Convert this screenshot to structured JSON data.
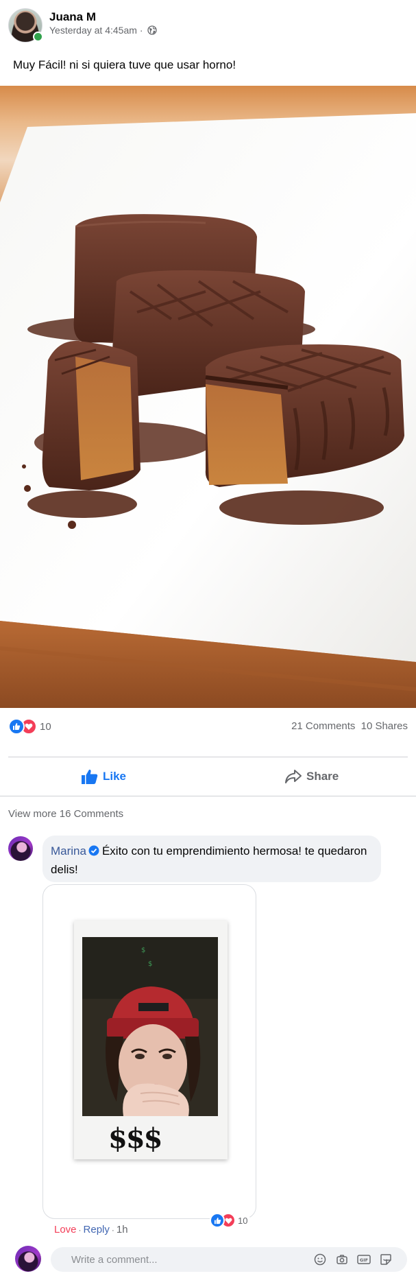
{
  "post": {
    "author": "Juana M",
    "timestamp": "Yesterday at 4:45am",
    "separator": "·",
    "privacy_icon": "globe-icon",
    "text": "Muy Fácil! ni si quiera tuve que usar horno!"
  },
  "stats": {
    "reaction_count": "10",
    "comments": "21 Comments",
    "shares": "10 Shares"
  },
  "actions": {
    "like_label": "Like",
    "share_label": "Share"
  },
  "comments_section": {
    "view_more": "View more 16 Comments",
    "comment": {
      "author": "Marina",
      "verified": true,
      "text": "Éxito con tu emprendimiento hermosa! te quedaron delis!",
      "image_sign": "$$$",
      "reaction_count": "10",
      "love_label": "Love",
      "reply_label": "Reply",
      "age": "1h"
    },
    "composer": {
      "placeholder": "Write a comment...",
      "icons": [
        "emoji-icon",
        "camera-icon",
        "gif-icon",
        "sticker-icon"
      ]
    }
  },
  "colors": {
    "brand_blue": "#1877f2",
    "love_red": "#f33e58",
    "name_link": "#385898",
    "muted_text": "#65676b",
    "bubble_bg": "#f0f2f5",
    "online_green": "#31a24c"
  }
}
